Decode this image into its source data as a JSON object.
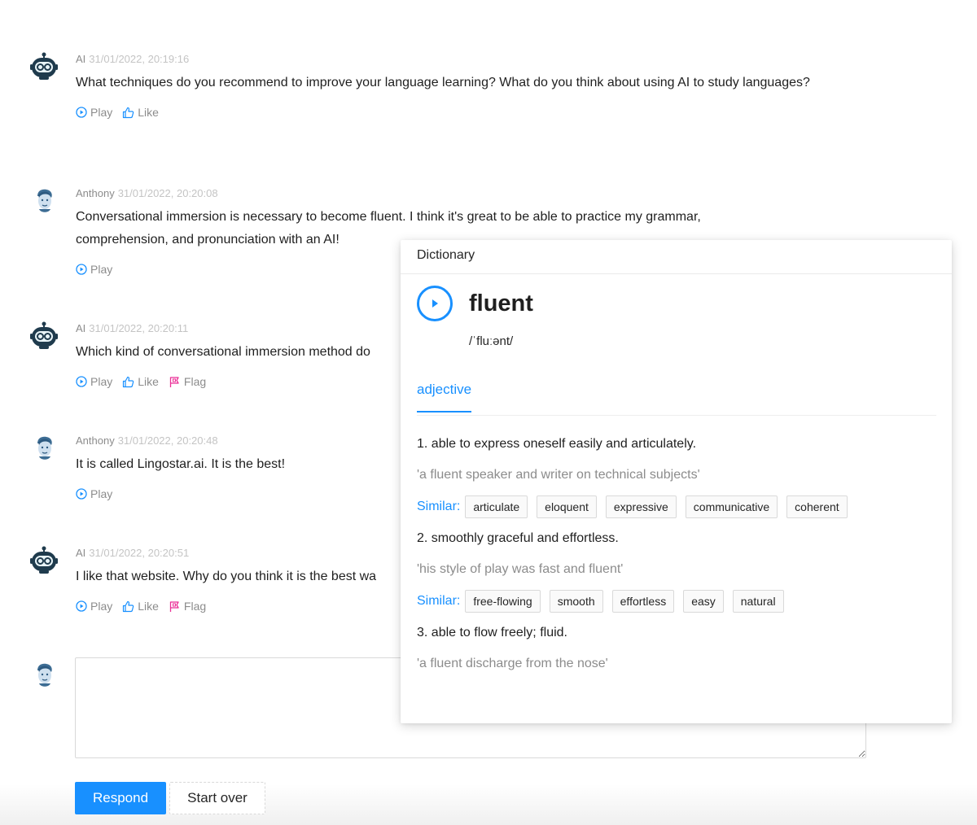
{
  "messages": [
    {
      "author": "AI",
      "time": "31/01/2022, 20:19:16",
      "text": "What techniques do you recommend to improve your language learning? What do you think about using AI to study languages?",
      "actions": [
        "Play",
        "Like"
      ]
    },
    {
      "author": "Anthony",
      "time": "31/01/2022, 20:20:08",
      "text": "Conversational immersion is necessary to become fluent. I think it's great to be able to practice my grammar, comprehension, and pronunciation with an AI!",
      "actions": [
        "Play"
      ]
    },
    {
      "author": "AI",
      "time": "31/01/2022, 20:20:11",
      "text": "Which kind of conversational immersion method do",
      "actions": [
        "Play",
        "Like",
        "Flag"
      ]
    },
    {
      "author": "Anthony",
      "time": "31/01/2022, 20:20:48",
      "text": "It is called Lingostar.ai. It is the best!",
      "actions": [
        "Play"
      ]
    },
    {
      "author": "AI",
      "time": "31/01/2022, 20:20:51",
      "text": "I like that website. Why do you think it is the best wa",
      "actions": [
        "Play",
        "Like",
        "Flag"
      ]
    }
  ],
  "labels": {
    "play": "Play",
    "like": "Like",
    "flag": "Flag"
  },
  "composer": {
    "value": "",
    "respond": "Respond",
    "start_over": "Start over"
  },
  "dictionary": {
    "header": "Dictionary",
    "word": "fluent",
    "phonetic": "/ˈfluːənt/",
    "tab": "adjective",
    "similar_label": "Similar:",
    "senses": [
      {
        "definition": "1. able to express oneself easily and articulately.",
        "example": "'a fluent speaker and writer on technical subjects'",
        "similar": [
          "articulate",
          "eloquent",
          "expressive",
          "communicative",
          "coherent"
        ]
      },
      {
        "definition": "2. smoothly graceful and effortless.",
        "example": "'his style of play was fast and fluent'",
        "similar": [
          "free-flowing",
          "smooth",
          "effortless",
          "easy",
          "natural"
        ]
      },
      {
        "definition": "3. able to flow freely; fluid.",
        "example": "'a fluent discharge from the nose'",
        "similar": []
      }
    ]
  },
  "colors": {
    "accent": "#1890ff",
    "flag": "#eb2f96",
    "muted": "#8c8c8c"
  }
}
